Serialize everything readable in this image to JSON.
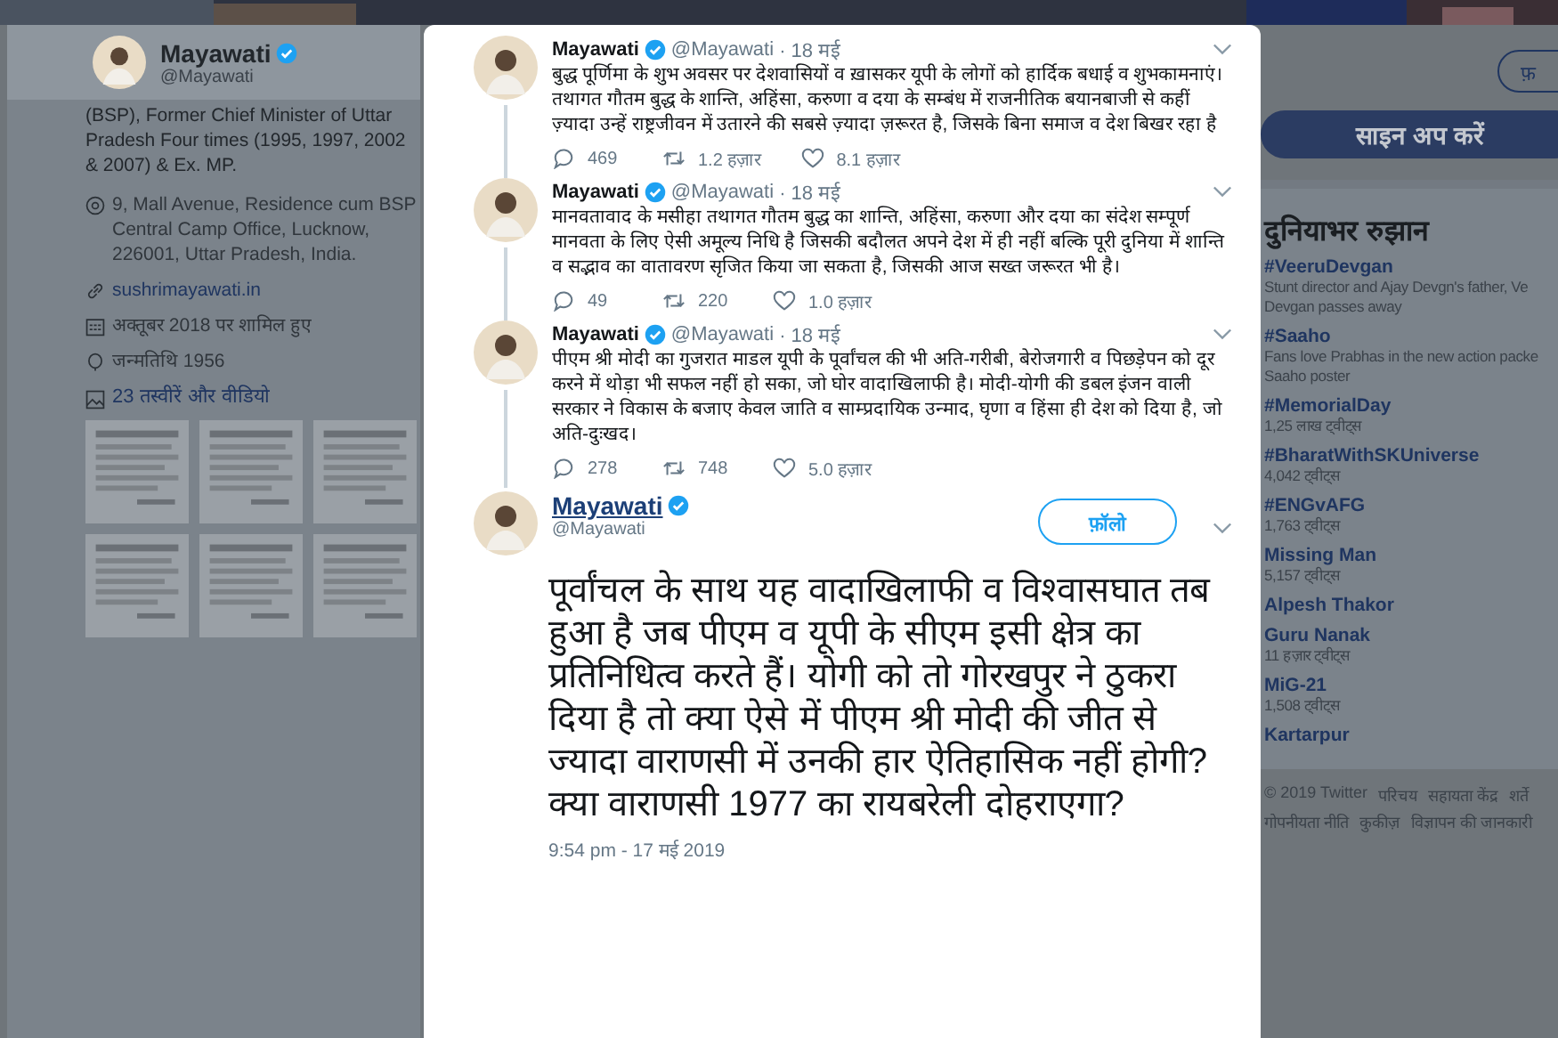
{
  "profile": {
    "name": "Mayawati",
    "verified": true,
    "handle": "@Mayawati",
    "bio": "(BSP), Former Chief Minister of Uttar Pradesh Four times (1995, 1997, 2002 & 2007) & Ex. MP.",
    "details": [
      {
        "kind": "location",
        "text": "9, Mall Avenue, Residence cum BSP Central Camp Office, Lucknow, 226001, Uttar Pradesh, India."
      },
      {
        "kind": "link",
        "text": "sushrimayawati.in"
      },
      {
        "kind": "calendar",
        "text": "अक्तूबर 2018 पर शामिल हुए"
      },
      {
        "kind": "birthday",
        "text": "जन्मतिथि 1956"
      }
    ],
    "media_link": "23 तस्वीरें और वीडियो"
  },
  "sidebar": {
    "follow_button": "फ़",
    "signup_button": "साइन अप करें",
    "trends_title": "दुनियाभर रुझान",
    "trends": [
      {
        "name": "#VeeruDevgan",
        "lines": [
          "Stunt director and Ajay Devgn's father, Ve",
          "Devgan passes away"
        ]
      },
      {
        "name": "#Saaho",
        "lines": [
          "Fans love Prabhas in the new action packe",
          "Saaho poster"
        ]
      },
      {
        "name": "#MemorialDay",
        "lines": [
          "1,25 लाख ट्वीट्स"
        ]
      },
      {
        "name": "#BharatWithSKUniverse",
        "lines": [
          "4,042 ट्वीट्स"
        ]
      },
      {
        "name": "#ENGvAFG",
        "lines": [
          "1,763 ट्वीट्स"
        ]
      },
      {
        "name": "Missing Man",
        "lines": [
          "5,157 ट्वीट्स"
        ]
      },
      {
        "name": "Alpesh Thakor"
      },
      {
        "name": "Guru Nanak",
        "lines": [
          "11 हज़ार ट्वीट्स"
        ]
      },
      {
        "name": "MiG-21",
        "lines": [
          "1,508 ट्वीट्स"
        ]
      },
      {
        "name": "Kartarpur"
      }
    ],
    "footer_links": [
      "© 2019 Twitter",
      "परिचय",
      "सहायता केंद्र",
      "शर्ते",
      "गोपनीयता नीति",
      "कुकीज़",
      "विज्ञापन की जानकारी"
    ]
  },
  "modal": {
    "thread": [
      {
        "name": "Mayawati",
        "verified": true,
        "handle": "@Mayawati",
        "time": "· 18 मई",
        "text": "बुद्ध पूर्णिमा के शुभ अवसर पर देशवासियों व ख़ासकर यूपी के लोगों को हार्दिक बधाई व शुभकामनाएं। तथागत गौतम बुद्ध के शान्ति, अहिंसा, करुणा व दया के सम्बंध में राजनीतिक बयानबाजी से कहीं ज़्यादा उन्हें राष्ट्रजीवन में उतारने की सबसे ज़्यादा ज़रूरत है, जिसके बिना समाज व देश बिखर रहा है",
        "replies": "469",
        "retweets": "1.2 हज़ार",
        "likes": "8.1 हज़ार"
      },
      {
        "name": "Mayawati",
        "verified": true,
        "handle": "@Mayawati",
        "time": "· 18 मई",
        "text": "मानवतावाद के मसीहा तथागत गौतम बुद्ध का शान्ति, अहिंसा, करुणा और दया का संदेश सम्पूर्ण मानवता के लिए ऐसी अमूल्य निधि है जिसकी बदौलत अपने देश में ही नहीं बल्कि पूरी दुनिया में शान्ति व सद्भाव का वातावरण सृजित किया जा सकता है, जिसकी आज सख्त जरूरत भी है।",
        "replies": "49",
        "retweets": "220",
        "likes": "1.0 हज़ार"
      },
      {
        "name": "Mayawati",
        "verified": true,
        "handle": "@Mayawati",
        "time": "· 18 मई",
        "text": "पीएम श्री मोदी का गुजरात माडल यूपी के पूर्वांचल की भी अति-गरीबी, बेरोजगारी व पिछड़ेपन को दूर करने में थोड़ा भी सफल नहीं हो सका, जो घोर वादाखिलाफी है। मोदी-योगी की डबल इंजन वाली सरकार ने विकास के बजाए केवल जाति व साम्प्रदायिक उन्माद, घृणा व हिंसा ही देश को दिया है, जो अति-दुःखद।",
        "replies": "278",
        "retweets": "748",
        "likes": "5.0 हज़ार"
      }
    ],
    "main": {
      "name": "Mayawati",
      "verified": true,
      "handle": "@Mayawati",
      "follow_button": "फ़ॉलो",
      "text": "पूर्वांचल के साथ यह वादाखिलाफी व विश्वासघात तब हुआ है जब पीएम व यूपी के सीएम इसी क्षेत्र का प्रतिनिधित्व करते हैं। योगी को तो गोरखपुर ने ठुकरा दिया है तो क्या ऐसे में पीएम श्री मोदी की जीत से ज्यादा वाराणसी में उनकी हार ऐतिहासिक नहीं होगी? क्या वाराणसी 1977 का रायबरेली दोहराएगा?",
      "timestamp": "9:54 pm - 17 मई 2019"
    }
  }
}
